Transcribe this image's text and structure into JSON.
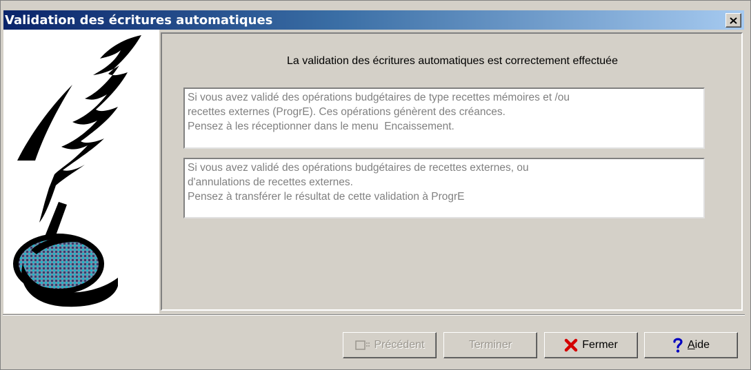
{
  "window": {
    "title": "Validation des écritures automatiques",
    "close_label": "✕"
  },
  "main": {
    "headline": "La validation des écritures automatiques est correctement effectuée",
    "message1": [
      "Si vous avez validé des opérations budgétaires de type recettes mémoires et /ou",
      "recettes externes (ProgrE). Ces opérations génèrent des créances.",
      "Pensez à les réceptionner dans le menu  Encaissement."
    ],
    "message2": [
      "Si vous avez validé des opérations budgétaires de recettes externes, ou",
      "d'annulations de recettes externes.",
      "Pensez à transférer le résultat de cette validation à ProgrE"
    ]
  },
  "footer": {
    "previous_label": "Précédent",
    "finish_label": "Terminer",
    "close_label": "Fermer",
    "help_label_prefix": "",
    "help_label_underlined": "A",
    "help_label_rest": "ide"
  },
  "icons": {
    "previous": "previous-icon",
    "close": "red-x-icon",
    "help": "question-icon",
    "illustration": "quill-inkwell-icon"
  },
  "colors": {
    "title_start": "#0a246a",
    "title_end": "#a6caf0",
    "close_x": "#d40000",
    "help_q": "#0000c0"
  }
}
